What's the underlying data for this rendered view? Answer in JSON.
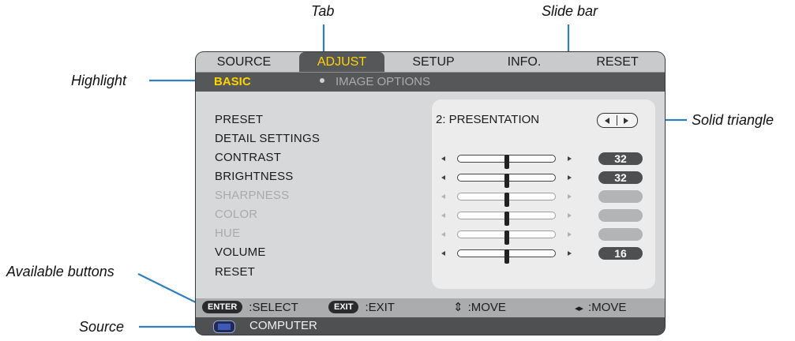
{
  "callouts": {
    "tab": "Tab",
    "slide_bar": "Slide bar",
    "highlight": "Highlight",
    "solid_triangle": "Solid triangle",
    "available_buttons": "Available buttons",
    "source": "Source"
  },
  "menu": {
    "tabs": [
      "SOURCE",
      "ADJUST",
      "SETUP",
      "INFO.",
      "RESET"
    ],
    "active_tab": "ADJUST",
    "subtabs": {
      "active": "BASIC",
      "inactive": "IMAGE OPTIONS"
    },
    "preset": {
      "label": "PRESET",
      "value": "2:  PRESENTATION"
    },
    "detail_settings": "DETAIL SETTINGS",
    "items": [
      {
        "label": "CONTRAST",
        "value": "32",
        "enabled": true,
        "level": 0.5
      },
      {
        "label": "BRIGHTNESS",
        "value": "32",
        "enabled": true,
        "level": 0.5
      },
      {
        "label": "SHARPNESS",
        "value": "",
        "enabled": false,
        "level": 0.5
      },
      {
        "label": "COLOR",
        "value": "",
        "enabled": false,
        "level": 0.5
      },
      {
        "label": "HUE",
        "value": "",
        "enabled": false,
        "level": 0.5
      },
      {
        "label": "VOLUME",
        "value": "16",
        "enabled": true,
        "level": 0.5
      }
    ],
    "reset": "RESET"
  },
  "help": {
    "enter_key": "ENTER",
    "select": ":SELECT",
    "exit_key": "EXIT",
    "exit": ":EXIT",
    "move_ud_icon": "⇕",
    "move_ud": ":MOVE",
    "move_lr_icon": "◂▸",
    "move_lr": ":MOVE"
  },
  "source": {
    "icon": "computer-icon",
    "label": "COMPUTER"
  },
  "colors": {
    "highlight": "#ffd400",
    "panel": "#555759",
    "body": "#d7d8d9"
  }
}
